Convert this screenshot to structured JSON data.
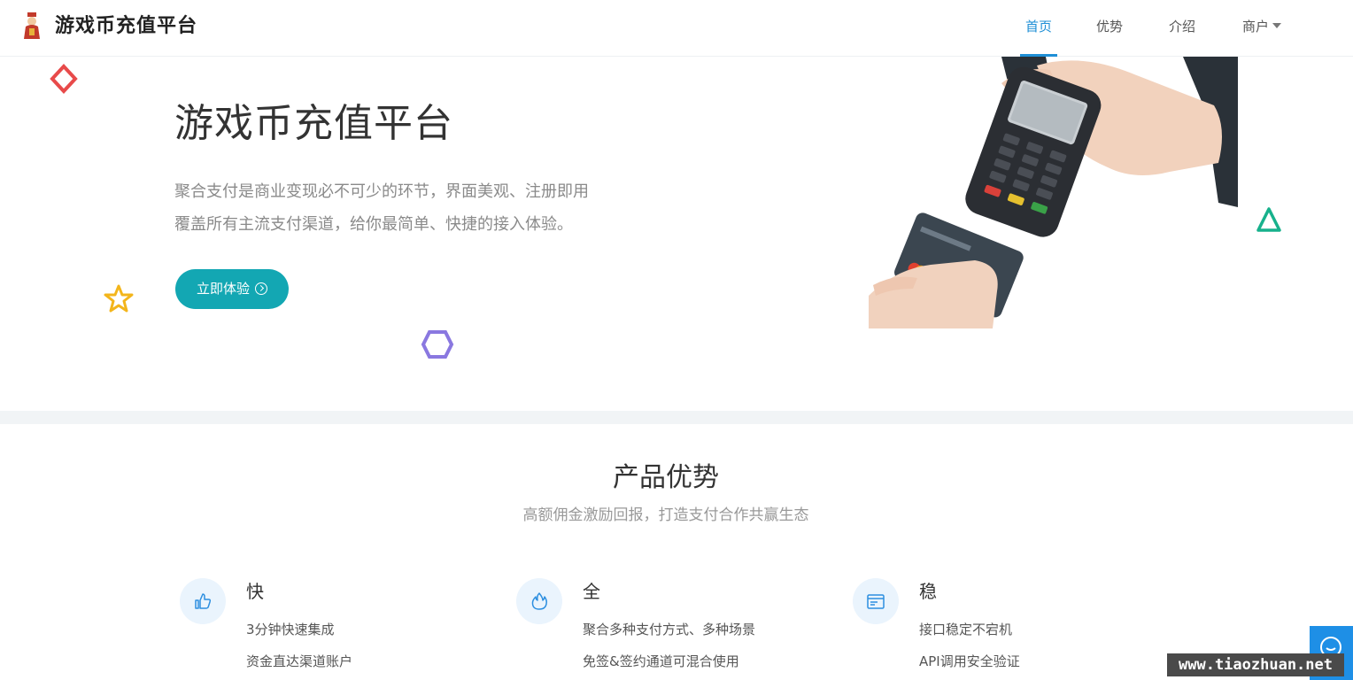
{
  "header": {
    "brand": "游戏币充值平台",
    "nav": [
      {
        "label": "首页",
        "active": true
      },
      {
        "label": "优势",
        "active": false
      },
      {
        "label": "介绍",
        "active": false
      },
      {
        "label": "商户",
        "active": false,
        "has_dropdown": true
      }
    ]
  },
  "hero": {
    "title": "游戏币充值平台",
    "description_lines": [
      "聚合支付是商业变现必不可少的环节，界面美观、注册即用",
      "覆盖所有主流支付渠道，给你最简单、快捷的接入体验。"
    ],
    "cta_label": "立即体验"
  },
  "features_section": {
    "title": "产品优势",
    "subtitle": "高额佣金激励回报，打造支付合作共赢生态",
    "items": [
      {
        "icon": "thumbs-up-icon",
        "name": "快",
        "lines": [
          "3分钟快速集成",
          "资金直达渠道账户"
        ]
      },
      {
        "icon": "flame-icon",
        "name": "全",
        "lines": [
          "聚合多种支付方式、多种场景",
          "免签&签约通道可混合使用"
        ]
      },
      {
        "icon": "browser-window-icon",
        "name": "稳",
        "lines": [
          "接口稳定不宕机",
          "API调用安全验证"
        ]
      }
    ]
  },
  "watermark": "www.tiaozhuan.net",
  "colors": {
    "accent": "#1f8fd6",
    "cta": "#13a7b3",
    "icon_bg": "#eaf4fd",
    "shape_red": "#e84a4a",
    "shape_yellow": "#f3b51b",
    "shape_purple": "#8a78e0",
    "shape_green": "#17b18c"
  }
}
